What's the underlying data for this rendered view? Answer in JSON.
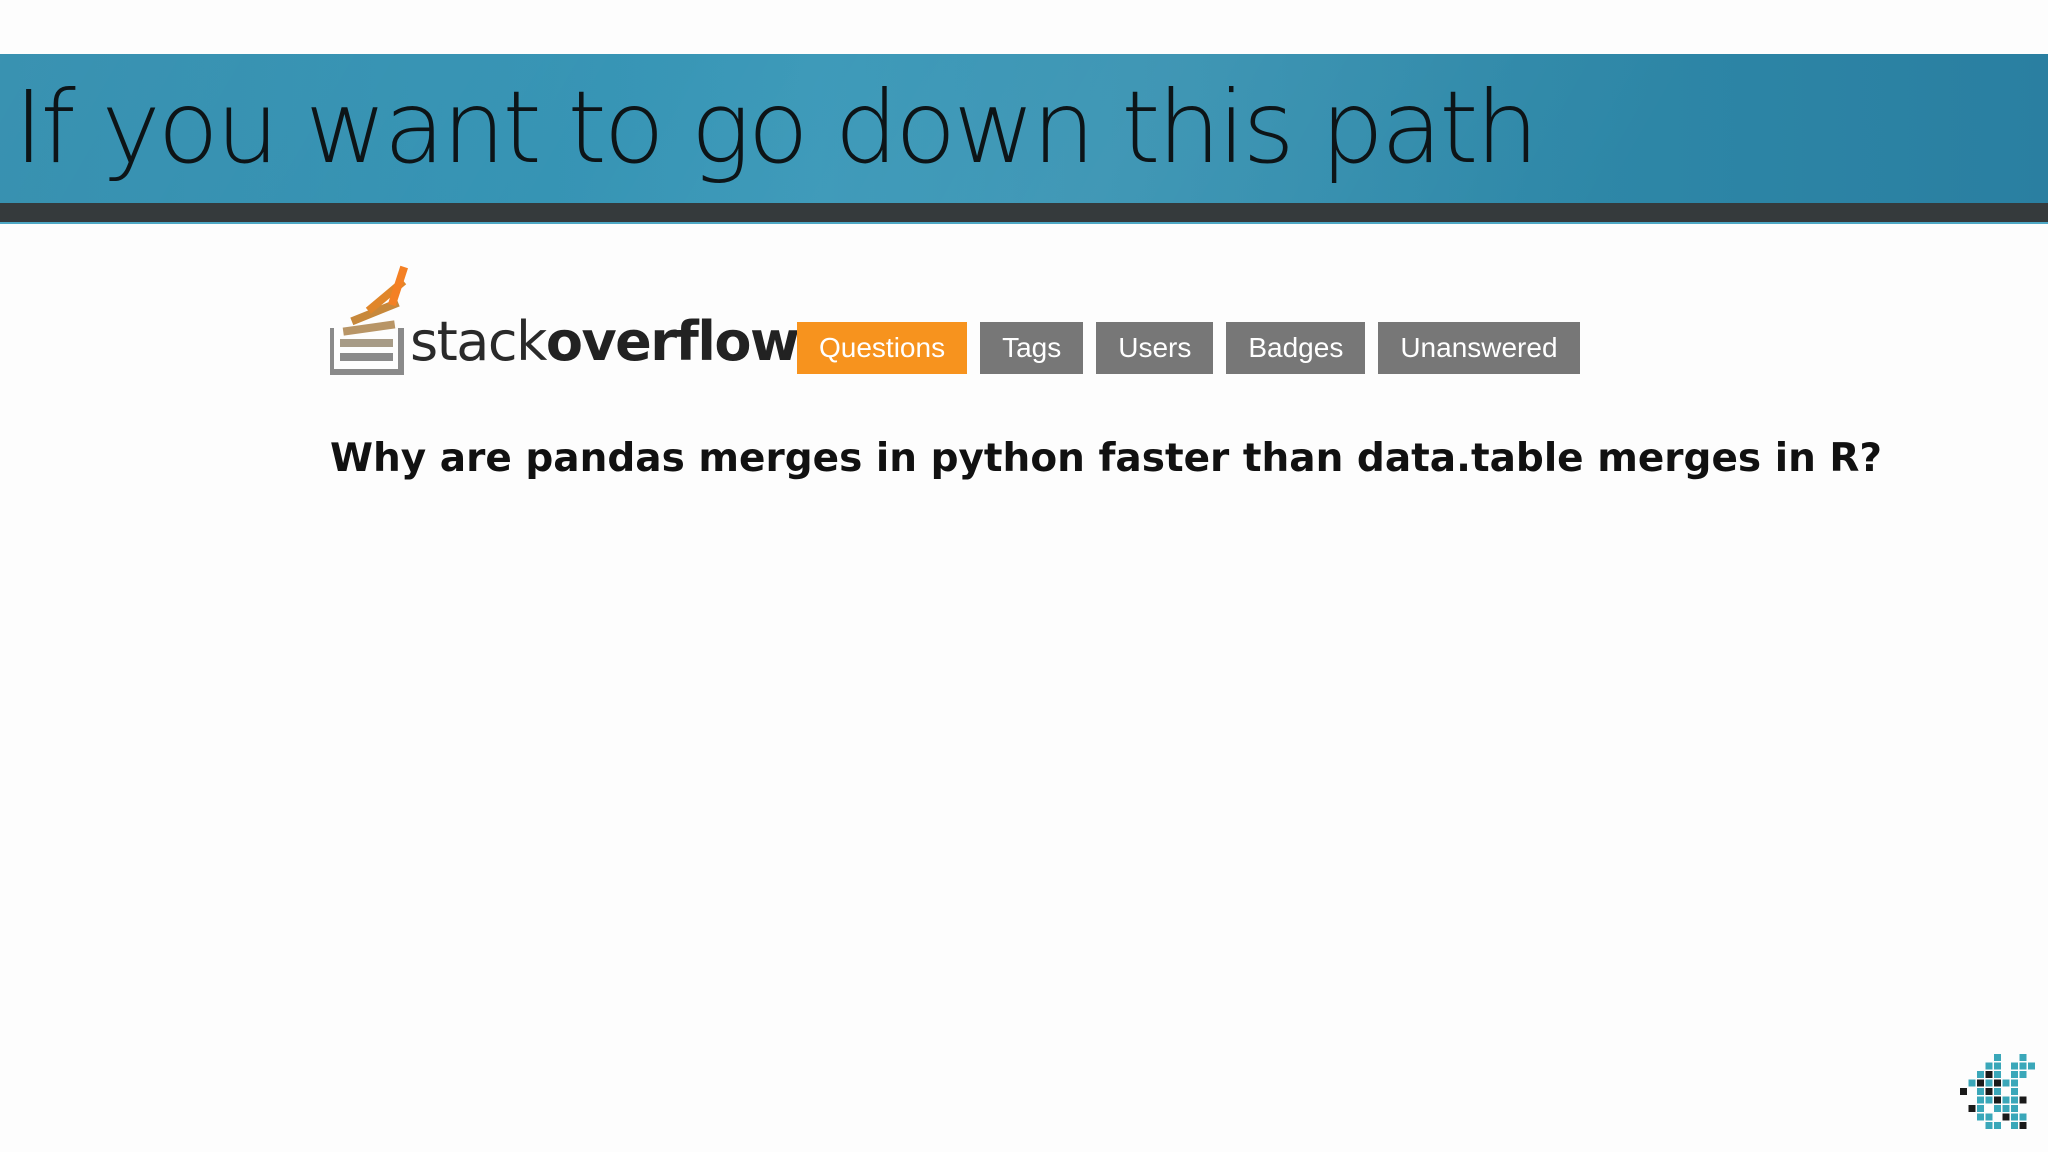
{
  "slide": {
    "title": "If you want to go down this path"
  },
  "site": {
    "logo_light": "stack",
    "logo_bold": "overflow",
    "logo_icon": "stackoverflow-logo-icon",
    "accent_color": "#f7931e",
    "nav_inactive_color": "#777777",
    "band_color": "#3a98b8"
  },
  "nav": {
    "items": [
      {
        "label": "Questions",
        "active": true
      },
      {
        "label": "Tags",
        "active": false
      },
      {
        "label": "Users",
        "active": false
      },
      {
        "label": "Badges",
        "active": false
      },
      {
        "label": "Unanswered",
        "active": false
      }
    ]
  },
  "question": {
    "title": "Why are pandas merges in python faster than data.table merges in R?"
  },
  "branding": {
    "corner_icon": "pixel-grid-logo-icon"
  }
}
